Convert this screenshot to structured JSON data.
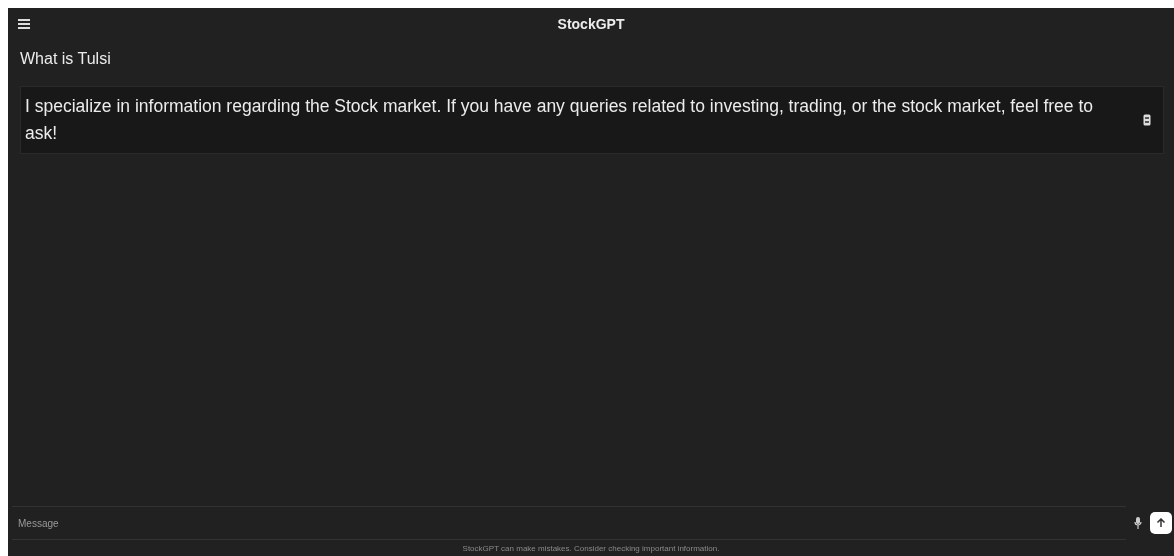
{
  "header": {
    "title": "StockGPT"
  },
  "messages": [
    {
      "kind": "question",
      "text": "What is Tulsi"
    },
    {
      "kind": "answer",
      "text": "I specialize in information regarding the Stock market. If you have any queries related to investing, trading, or the stock market, feel free to ask!"
    }
  ],
  "composer": {
    "placeholder": "Message"
  },
  "footer": "StockGPT can make mistakes. Consider checking important information."
}
